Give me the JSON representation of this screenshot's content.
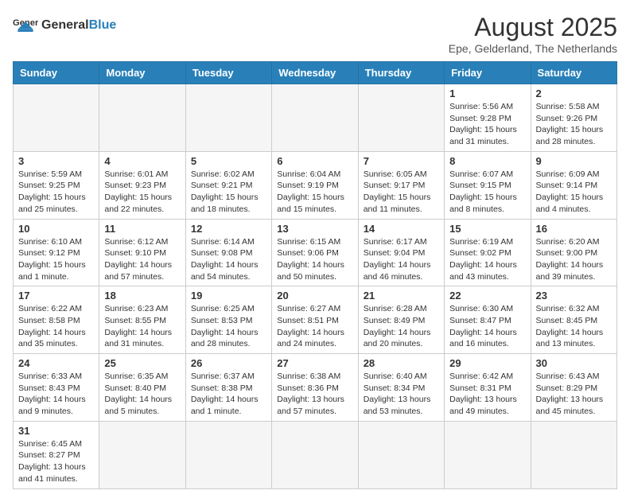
{
  "header": {
    "logo_general": "General",
    "logo_blue": "Blue",
    "month_title": "August 2025",
    "subtitle": "Epe, Gelderland, The Netherlands"
  },
  "days_of_week": [
    "Sunday",
    "Monday",
    "Tuesday",
    "Wednesday",
    "Thursday",
    "Friday",
    "Saturday"
  ],
  "weeks": [
    [
      {
        "day": "",
        "info": ""
      },
      {
        "day": "",
        "info": ""
      },
      {
        "day": "",
        "info": ""
      },
      {
        "day": "",
        "info": ""
      },
      {
        "day": "",
        "info": ""
      },
      {
        "day": "1",
        "info": "Sunrise: 5:56 AM\nSunset: 9:28 PM\nDaylight: 15 hours and 31 minutes."
      },
      {
        "day": "2",
        "info": "Sunrise: 5:58 AM\nSunset: 9:26 PM\nDaylight: 15 hours and 28 minutes."
      }
    ],
    [
      {
        "day": "3",
        "info": "Sunrise: 5:59 AM\nSunset: 9:25 PM\nDaylight: 15 hours and 25 minutes."
      },
      {
        "day": "4",
        "info": "Sunrise: 6:01 AM\nSunset: 9:23 PM\nDaylight: 15 hours and 22 minutes."
      },
      {
        "day": "5",
        "info": "Sunrise: 6:02 AM\nSunset: 9:21 PM\nDaylight: 15 hours and 18 minutes."
      },
      {
        "day": "6",
        "info": "Sunrise: 6:04 AM\nSunset: 9:19 PM\nDaylight: 15 hours and 15 minutes."
      },
      {
        "day": "7",
        "info": "Sunrise: 6:05 AM\nSunset: 9:17 PM\nDaylight: 15 hours and 11 minutes."
      },
      {
        "day": "8",
        "info": "Sunrise: 6:07 AM\nSunset: 9:15 PM\nDaylight: 15 hours and 8 minutes."
      },
      {
        "day": "9",
        "info": "Sunrise: 6:09 AM\nSunset: 9:14 PM\nDaylight: 15 hours and 4 minutes."
      }
    ],
    [
      {
        "day": "10",
        "info": "Sunrise: 6:10 AM\nSunset: 9:12 PM\nDaylight: 15 hours and 1 minute."
      },
      {
        "day": "11",
        "info": "Sunrise: 6:12 AM\nSunset: 9:10 PM\nDaylight: 14 hours and 57 minutes."
      },
      {
        "day": "12",
        "info": "Sunrise: 6:14 AM\nSunset: 9:08 PM\nDaylight: 14 hours and 54 minutes."
      },
      {
        "day": "13",
        "info": "Sunrise: 6:15 AM\nSunset: 9:06 PM\nDaylight: 14 hours and 50 minutes."
      },
      {
        "day": "14",
        "info": "Sunrise: 6:17 AM\nSunset: 9:04 PM\nDaylight: 14 hours and 46 minutes."
      },
      {
        "day": "15",
        "info": "Sunrise: 6:19 AM\nSunset: 9:02 PM\nDaylight: 14 hours and 43 minutes."
      },
      {
        "day": "16",
        "info": "Sunrise: 6:20 AM\nSunset: 9:00 PM\nDaylight: 14 hours and 39 minutes."
      }
    ],
    [
      {
        "day": "17",
        "info": "Sunrise: 6:22 AM\nSunset: 8:58 PM\nDaylight: 14 hours and 35 minutes."
      },
      {
        "day": "18",
        "info": "Sunrise: 6:23 AM\nSunset: 8:55 PM\nDaylight: 14 hours and 31 minutes."
      },
      {
        "day": "19",
        "info": "Sunrise: 6:25 AM\nSunset: 8:53 PM\nDaylight: 14 hours and 28 minutes."
      },
      {
        "day": "20",
        "info": "Sunrise: 6:27 AM\nSunset: 8:51 PM\nDaylight: 14 hours and 24 minutes."
      },
      {
        "day": "21",
        "info": "Sunrise: 6:28 AM\nSunset: 8:49 PM\nDaylight: 14 hours and 20 minutes."
      },
      {
        "day": "22",
        "info": "Sunrise: 6:30 AM\nSunset: 8:47 PM\nDaylight: 14 hours and 16 minutes."
      },
      {
        "day": "23",
        "info": "Sunrise: 6:32 AM\nSunset: 8:45 PM\nDaylight: 14 hours and 13 minutes."
      }
    ],
    [
      {
        "day": "24",
        "info": "Sunrise: 6:33 AM\nSunset: 8:43 PM\nDaylight: 14 hours and 9 minutes."
      },
      {
        "day": "25",
        "info": "Sunrise: 6:35 AM\nSunset: 8:40 PM\nDaylight: 14 hours and 5 minutes."
      },
      {
        "day": "26",
        "info": "Sunrise: 6:37 AM\nSunset: 8:38 PM\nDaylight: 14 hours and 1 minute."
      },
      {
        "day": "27",
        "info": "Sunrise: 6:38 AM\nSunset: 8:36 PM\nDaylight: 13 hours and 57 minutes."
      },
      {
        "day": "28",
        "info": "Sunrise: 6:40 AM\nSunset: 8:34 PM\nDaylight: 13 hours and 53 minutes."
      },
      {
        "day": "29",
        "info": "Sunrise: 6:42 AM\nSunset: 8:31 PM\nDaylight: 13 hours and 49 minutes."
      },
      {
        "day": "30",
        "info": "Sunrise: 6:43 AM\nSunset: 8:29 PM\nDaylight: 13 hours and 45 minutes."
      }
    ],
    [
      {
        "day": "31",
        "info": "Sunrise: 6:45 AM\nSunset: 8:27 PM\nDaylight: 13 hours and 41 minutes."
      },
      {
        "day": "",
        "info": ""
      },
      {
        "day": "",
        "info": ""
      },
      {
        "day": "",
        "info": ""
      },
      {
        "day": "",
        "info": ""
      },
      {
        "day": "",
        "info": ""
      },
      {
        "day": "",
        "info": ""
      }
    ]
  ]
}
